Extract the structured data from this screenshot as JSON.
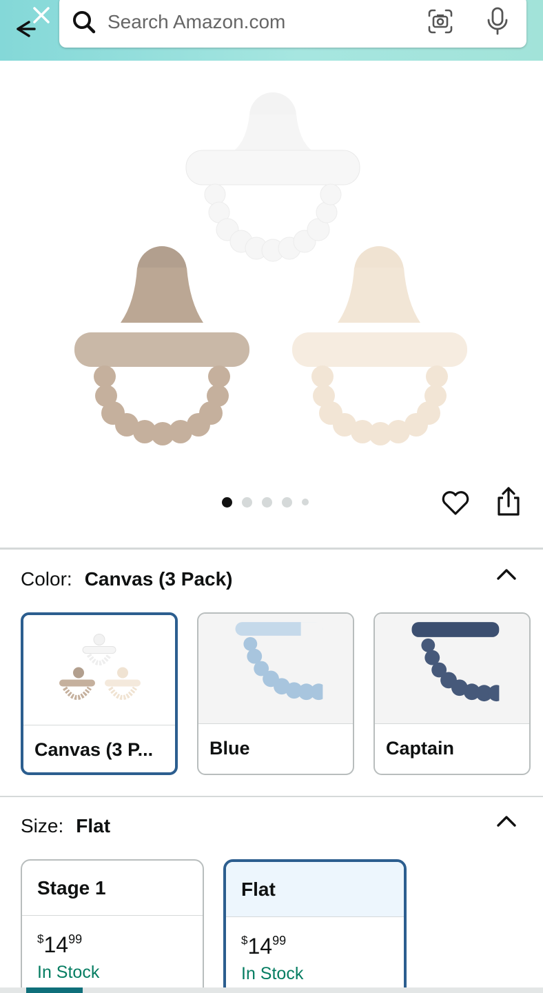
{
  "header": {
    "search_placeholder": "Search Amazon.com",
    "icons": [
      "back-arrow-icon",
      "close-icon",
      "search-icon",
      "camera-scan-icon",
      "microphone-icon"
    ]
  },
  "gallery": {
    "image_count": 5,
    "active_index": 0,
    "image_alt": "Three silicone pacifiers: white, taupe, cream",
    "icons": [
      "heart-icon",
      "share-icon"
    ]
  },
  "color": {
    "label": "Color:",
    "selected_value": "Canvas (3 Pack)",
    "options": [
      {
        "name": "Canvas (3 P...",
        "selected": true
      },
      {
        "name": "Blue",
        "selected": false
      },
      {
        "name": "Captain",
        "selected": false
      }
    ]
  },
  "size": {
    "label": "Size:",
    "selected_value": "Flat",
    "options": [
      {
        "name": "Stage 1",
        "currency": "$",
        "whole": "14",
        "cents": "99",
        "stock": "In Stock",
        "selected": false
      },
      {
        "name": "Flat",
        "currency": "$",
        "whole": "14",
        "cents": "99",
        "stock": "In Stock",
        "selected": true
      }
    ]
  },
  "colors": {
    "accent_border": "#2c5e8f",
    "in_stock": "#067d62",
    "header_gradient": "#84d8d8"
  }
}
